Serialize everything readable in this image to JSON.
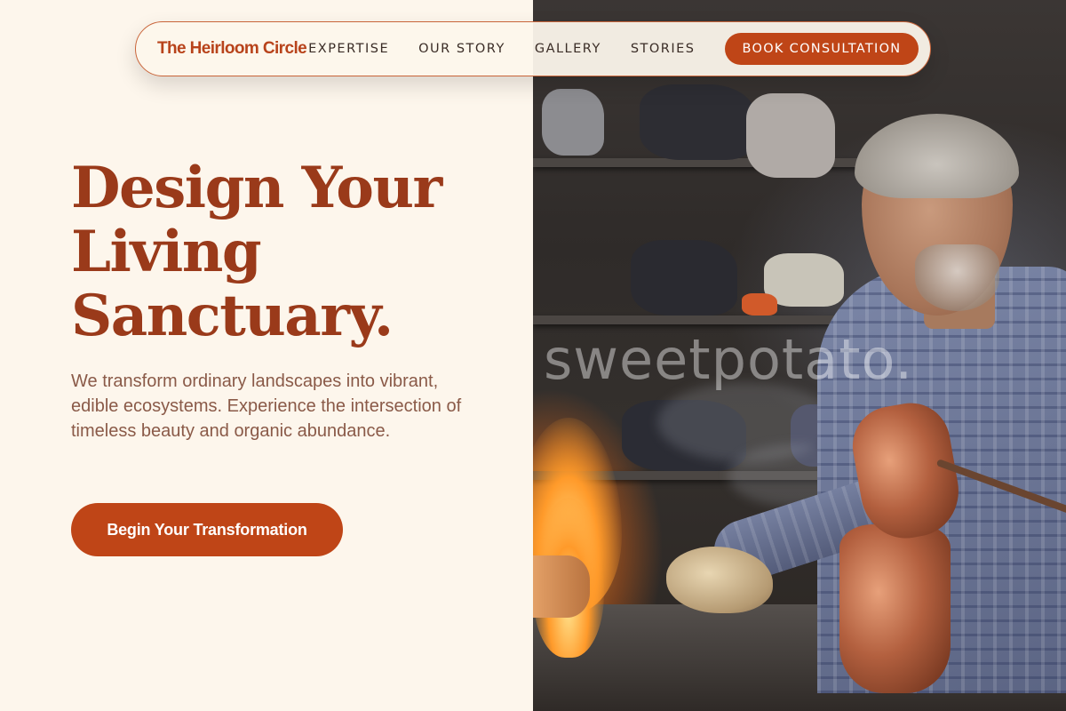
{
  "nav": {
    "brand": "The Heirloom Circle",
    "links": [
      {
        "label": "EXPERTISE"
      },
      {
        "label": "OUR STORY"
      },
      {
        "label": "GALLERY"
      },
      {
        "label": "STORIES"
      }
    ],
    "cta_label": "BOOK CONSULTATION"
  },
  "hero": {
    "headline_lines": [
      "Design Your",
      "Living",
      "Sanctuary."
    ],
    "subtext": "We transform ordinary landscapes into vibrant, edible ecosystems. Experience the intersection of timeless beauty and organic abundance.",
    "button_label": "Begin Your Transformation"
  },
  "photo": {
    "subject": "artisan-metalworker-photo",
    "watermark": "sweetpotato."
  },
  "colors": {
    "accent": "#bf4517",
    "headline": "#9a3a1a",
    "background": "#fdf6ec",
    "body_text": "#8a5a48"
  }
}
